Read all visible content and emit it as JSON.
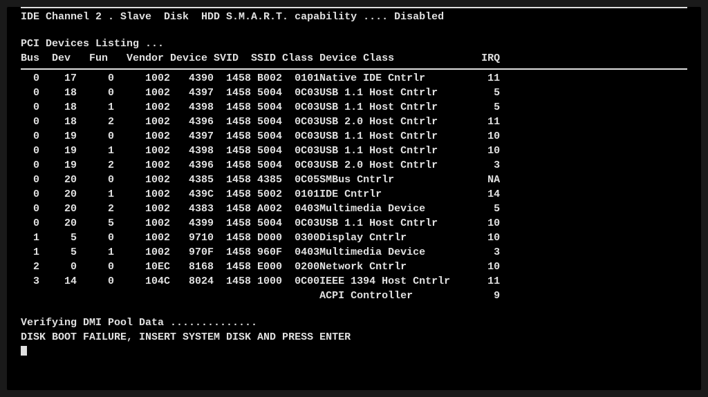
{
  "top_line": "IDE Channel 2 . Slave  Disk  HDD S.M.A.R.T. capability .... Disabled",
  "pci_listing_title": "PCI Devices Listing ...",
  "columns": {
    "bus": "Bus",
    "dev": "Dev",
    "fun": "Fun",
    "vendor": "Vendor",
    "device": "Device",
    "svid": "SVID",
    "ssid": "SSID",
    "class": "Class",
    "device_class": "Device Class",
    "irq": "IRQ"
  },
  "devices": [
    {
      "bus": "0",
      "dev": "17",
      "fun": "0",
      "vendor": "1002",
      "device": "4390",
      "svid": "1458",
      "ssid": "B002",
      "class": "0101",
      "device_class": "Native IDE Cntrlr",
      "irq": "11"
    },
    {
      "bus": "0",
      "dev": "18",
      "fun": "0",
      "vendor": "1002",
      "device": "4397",
      "svid": "1458",
      "ssid": "5004",
      "class": "0C03",
      "device_class": "USB 1.1 Host Cntrlr",
      "irq": "5"
    },
    {
      "bus": "0",
      "dev": "18",
      "fun": "1",
      "vendor": "1002",
      "device": "4398",
      "svid": "1458",
      "ssid": "5004",
      "class": "0C03",
      "device_class": "USB 1.1 Host Cntrlr",
      "irq": "5"
    },
    {
      "bus": "0",
      "dev": "18",
      "fun": "2",
      "vendor": "1002",
      "device": "4396",
      "svid": "1458",
      "ssid": "5004",
      "class": "0C03",
      "device_class": "USB 2.0 Host Cntrlr",
      "irq": "11"
    },
    {
      "bus": "0",
      "dev": "19",
      "fun": "0",
      "vendor": "1002",
      "device": "4397",
      "svid": "1458",
      "ssid": "5004",
      "class": "0C03",
      "device_class": "USB 1.1 Host Cntrlr",
      "irq": "10"
    },
    {
      "bus": "0",
      "dev": "19",
      "fun": "1",
      "vendor": "1002",
      "device": "4398",
      "svid": "1458",
      "ssid": "5004",
      "class": "0C03",
      "device_class": "USB 1.1 Host Cntrlr",
      "irq": "10"
    },
    {
      "bus": "0",
      "dev": "19",
      "fun": "2",
      "vendor": "1002",
      "device": "4396",
      "svid": "1458",
      "ssid": "5004",
      "class": "0C03",
      "device_class": "USB 2.0 Host Cntrlr",
      "irq": "3"
    },
    {
      "bus": "0",
      "dev": "20",
      "fun": "0",
      "vendor": "1002",
      "device": "4385",
      "svid": "1458",
      "ssid": "4385",
      "class": "0C05",
      "device_class": "SMBus Cntrlr",
      "irq": "NA"
    },
    {
      "bus": "0",
      "dev": "20",
      "fun": "1",
      "vendor": "1002",
      "device": "439C",
      "svid": "1458",
      "ssid": "5002",
      "class": "0101",
      "device_class": "IDE Cntrlr",
      "irq": "14"
    },
    {
      "bus": "0",
      "dev": "20",
      "fun": "2",
      "vendor": "1002",
      "device": "4383",
      "svid": "1458",
      "ssid": "A002",
      "class": "0403",
      "device_class": "Multimedia Device",
      "irq": "5"
    },
    {
      "bus": "0",
      "dev": "20",
      "fun": "5",
      "vendor": "1002",
      "device": "4399",
      "svid": "1458",
      "ssid": "5004",
      "class": "0C03",
      "device_class": "USB 1.1 Host Cntrlr",
      "irq": "10"
    },
    {
      "bus": "1",
      "dev": "5",
      "fun": "0",
      "vendor": "1002",
      "device": "9710",
      "svid": "1458",
      "ssid": "D000",
      "class": "0300",
      "device_class": "Display Cntrlr",
      "irq": "10"
    },
    {
      "bus": "1",
      "dev": "5",
      "fun": "1",
      "vendor": "1002",
      "device": "970F",
      "svid": "1458",
      "ssid": "960F",
      "class": "0403",
      "device_class": "Multimedia Device",
      "irq": "3"
    },
    {
      "bus": "2",
      "dev": "0",
      "fun": "0",
      "vendor": "10EC",
      "device": "8168",
      "svid": "1458",
      "ssid": "E000",
      "class": "0200",
      "device_class": "Network Cntrlr",
      "irq": "10"
    },
    {
      "bus": "3",
      "dev": "14",
      "fun": "0",
      "vendor": "104C",
      "device": "8024",
      "svid": "1458",
      "ssid": "1000",
      "class": "0C00",
      "device_class": "IEEE 1394 Host Cntrlr",
      "irq": "11"
    }
  ],
  "acpi": {
    "device_class": "ACPI Controller",
    "irq": "9"
  },
  "verifying_line": "Verifying DMI Pool Data ..............",
  "boot_failure_line": "DISK BOOT FAILURE, INSERT SYSTEM DISK AND PRESS ENTER"
}
